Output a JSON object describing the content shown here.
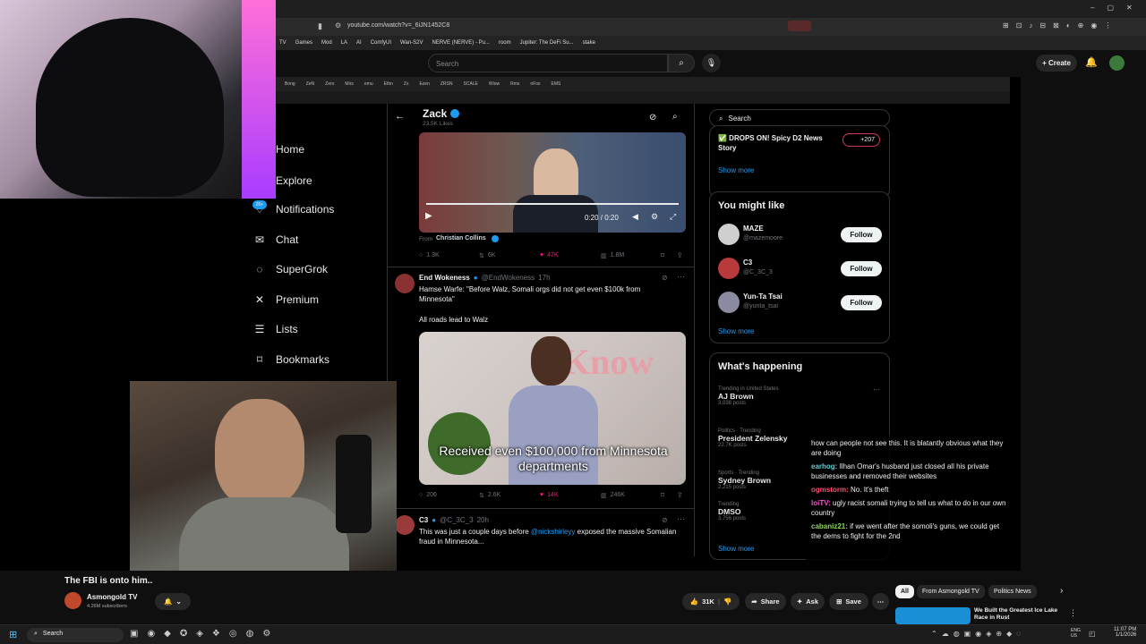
{
  "browser": {
    "url": "youtube.com/watch?v=_6iJN1452C8",
    "bookmarks": [
      "TV",
      "Games",
      "Mod",
      "LA",
      "AI",
      "ComfyUI",
      "Wan-S2V",
      "NERVE (NERVE) - Pu...",
      "room",
      "Jupiter: The DeFi Su...",
      "stake"
    ]
  },
  "youtube": {
    "search_placeholder": "Search",
    "create_label": "Create",
    "video_title": "The FBI is onto him..",
    "channel_name": "Asmongold TV",
    "subscribers": "4.26M subscribers",
    "likes": "31K",
    "share_label": "Share",
    "ask_label": "Ask",
    "save_label": "Save",
    "chips": [
      "All",
      "From Asmongold TV",
      "Politics News"
    ],
    "rec_title": "We Built the Greatest Ice Lake Race in Rust"
  },
  "inner_tabs": [
    "Bong",
    "ZeN",
    "Zero",
    "Mirs",
    "emu",
    "Ethn",
    "Zx",
    "Ezen",
    "ZRSN",
    "SCALE",
    "Wiow",
    "Rms",
    "nFox",
    "EMS"
  ],
  "x_nav": [
    {
      "label": "Home",
      "icon": "home-icon"
    },
    {
      "label": "Explore",
      "icon": "explore-icon"
    },
    {
      "label": "Notifications",
      "icon": "bell-icon",
      "badge": "20+"
    },
    {
      "label": "Chat",
      "icon": "mail-icon"
    },
    {
      "label": "SuperGrok",
      "icon": "grok-icon"
    },
    {
      "label": "Premium",
      "icon": "x-icon"
    },
    {
      "label": "Lists",
      "icon": "list-icon"
    },
    {
      "label": "Bookmarks",
      "icon": "bookmark-icon"
    }
  ],
  "profile": {
    "name": "Zack",
    "likes": "23.5K Likes"
  },
  "tweet0": {
    "video_time": "0:20 / 0:20",
    "from_label": "From",
    "from_name": "Christian Collins",
    "replies": "1.3K",
    "retweets": "6K",
    "likes": "47K",
    "views": "1.8M"
  },
  "tweet1": {
    "name": "End Wokeness",
    "handle": "@EndWokeness",
    "time": "17h",
    "text": "Hamse Warfe: \"Before Walz, Somali orgs did not get even $100k from Minnesota\"",
    "text2": "All roads lead to Walz",
    "caption": "Received even $100,000 from Minnesota departments",
    "replies": "206",
    "retweets": "2.6K",
    "likes": "14K",
    "views": "246K"
  },
  "tweet2": {
    "name": "C3",
    "handle": "@C_3C_3",
    "time": "20h",
    "text_a": "This was just a couple days before",
    "mention": "@nickshirleyy",
    "text_b": "exposed the massive Somalian fraud in Minnesota..."
  },
  "right": {
    "search_placeholder": "Search",
    "news_title": "✅ DROPS ON! Spicy D2 News Story",
    "news_count": "+207",
    "show_more": "Show more",
    "you_might_like": "You might like",
    "follow_label": "Follow",
    "suggestions": [
      {
        "name": "MAZE",
        "handle": "@mazemoore"
      },
      {
        "name": "C3",
        "handle": "@C_3C_3"
      },
      {
        "name": "Yun-Ta Tsai",
        "handle": "@yunta_tsai"
      }
    ],
    "whats_happening": "What's happening",
    "trends": [
      {
        "meta": "Trending in United States",
        "name": "AJ Brown",
        "posts": "3,038 posts"
      },
      {
        "meta": "Politics · Trending",
        "name": "President Zelensky",
        "posts": "22.7K posts"
      },
      {
        "meta": "Sports · Trending",
        "name": "Sydney Brown",
        "posts": "2,215 posts"
      },
      {
        "meta": "Trending",
        "name": "DMSO",
        "posts": "3,756 posts"
      }
    ]
  },
  "chat": [
    {
      "user": "",
      "color": "#9b6bff",
      "msg": "how can people not see this. It is blatantly obvious what they are doing"
    },
    {
      "user": "earhog:",
      "color": "#5ad3d3",
      "msg": "Ilhan Omar's husband just closed all his private businesses and removed their websites"
    },
    {
      "user": "ogmstorm:",
      "color": "#ff4d6d",
      "msg": "No. It's theft"
    },
    {
      "user": "loiTV:",
      "color": "#ff4dd2",
      "msg": "ugly racist somali trying to tell us what to do in our own country"
    },
    {
      "user": "cabaniz21:",
      "color": "#8ad65a",
      "msg": "if we went after the somoli's guns, we could get the dems to fight for the 2nd"
    }
  ],
  "taskbar": {
    "search": "Search",
    "lang": "ENG US",
    "time": "11:07 PM",
    "date": "1/1/2026"
  }
}
